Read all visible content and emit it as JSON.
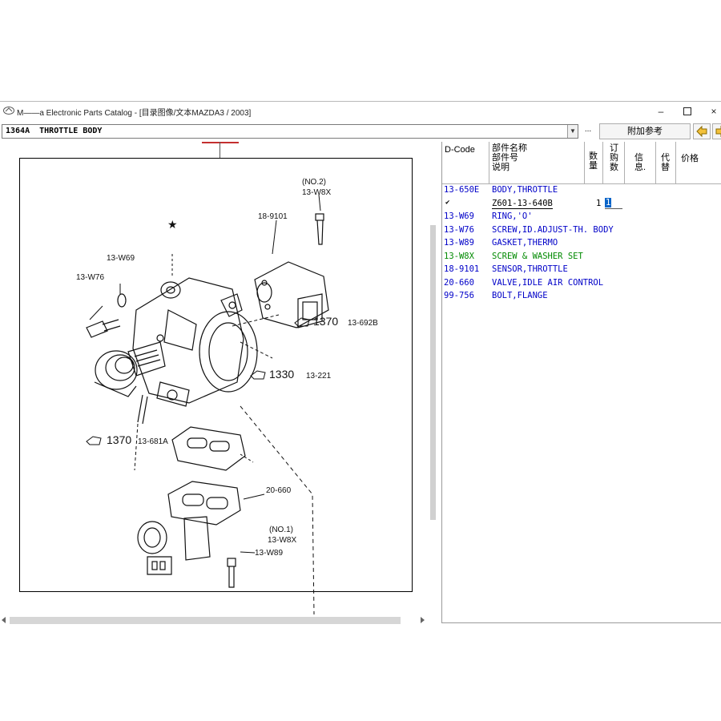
{
  "window": {
    "title": "M——a Electronic Parts Catalog - [目录图像/文本MAZDA3 / 2003]",
    "controls": [
      "–",
      "☐",
      "×"
    ]
  },
  "toolbar": {
    "section_value": "1364A  THROTTLE BODY",
    "dots_label": "...",
    "extra_button": "附加参考"
  },
  "drawing": {
    "callouts": {
      "no2": "(NO.2)",
      "w8x_top": "13-W8X",
      "p189101": "18-9101",
      "w69": "13-W69",
      "w76": "13-W76",
      "c1370b": "1370",
      "c1370b_ref": "13-692B",
      "c1330": "1330",
      "c1330_ref": "13-221",
      "c1370a": "1370",
      "c1370a_ref": "13-681A",
      "w89": "13-W89",
      "p20660": "20-660",
      "no1": "(NO.1)",
      "w8x_bottom": "13-W8X",
      "star": "★"
    }
  },
  "parts_table": {
    "headers": {
      "dcode": "D-Code",
      "name": [
        "部件名称",
        "部件号",
        "说明"
      ],
      "qty": [
        "数",
        "量"
      ],
      "order": [
        "订",
        "购",
        "数"
      ],
      "info": [
        "信",
        "息."
      ],
      "sub": [
        "代",
        "替"
      ],
      "price": "价格"
    },
    "rows": [
      {
        "code": "13-650E",
        "desc": "BODY,THROTTLE",
        "color": "blue"
      },
      {
        "code": "✔",
        "desc": "Z601-13-640B",
        "qty": "1",
        "order": "1",
        "color": "black"
      },
      {
        "code": "13-W69",
        "desc": "RING,'O'",
        "color": "blue"
      },
      {
        "code": "13-W76",
        "desc": "SCREW,ID.ADJUST-TH. BODY",
        "color": "blue"
      },
      {
        "code": "13-W89",
        "desc": "GASKET,THERMO",
        "color": "blue"
      },
      {
        "code": "13-W8X",
        "desc": "SCREW & WASHER SET",
        "color": "green"
      },
      {
        "code": "18-9101",
        "desc": "SENSOR,THROTTLE",
        "color": "blue"
      },
      {
        "code": "20-660",
        "desc": "VALVE,IDLE AIR CONTROL",
        "color": "blue"
      },
      {
        "code": "99-756",
        "desc": "BOLT,FLANGE",
        "color": "blue"
      }
    ]
  }
}
